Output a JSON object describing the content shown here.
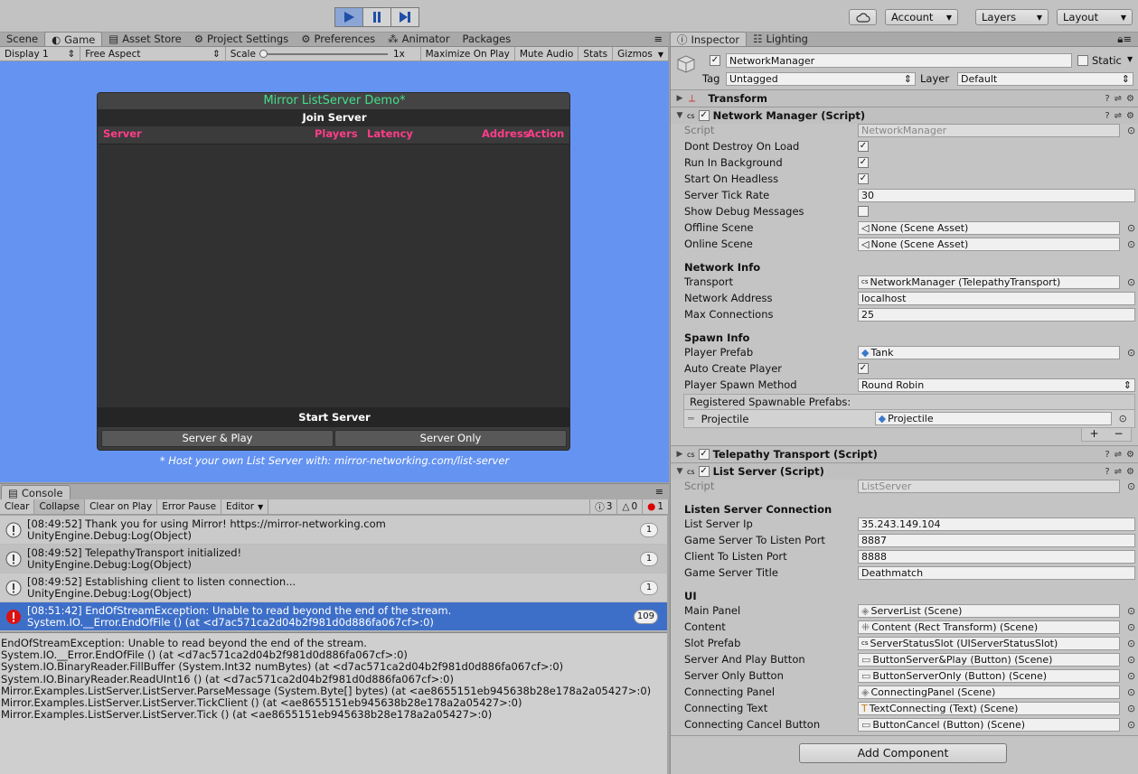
{
  "toolbar": {
    "cloud_icon": "cloud-icon",
    "account": "Account",
    "layers": "Layers",
    "layout": "Layout"
  },
  "left_tabs": [
    "Scene",
    "Game",
    "Asset Store",
    "Project Settings",
    "Preferences",
    "Animator",
    "Packages"
  ],
  "right_tabs": [
    "Inspector",
    "Lighting"
  ],
  "game_toolbar": {
    "display": "Display 1",
    "aspect": "Free Aspect",
    "scale_label": "Scale",
    "scale_value": "1x",
    "maximize": "Maximize On Play",
    "mute": "Mute Audio",
    "stats": "Stats",
    "gizmos": "Gizmos"
  },
  "game_panel": {
    "title": "Mirror ListServer Demo*",
    "join": "Join Server",
    "col_server": "Server",
    "col_players": "Players",
    "col_latency": "Latency",
    "col_address": "Address",
    "col_action": "Action",
    "start": "Start Server",
    "btn_server_play": "Server & Play",
    "btn_server_only": "Server Only",
    "hint": "* Host your own List Server with: mirror-networking.com/list-server"
  },
  "console": {
    "tab": "Console",
    "clear": "Clear",
    "collapse": "Collapse",
    "clear_on_play": "Clear on Play",
    "error_pause": "Error Pause",
    "editor": "Editor",
    "count_info": "3",
    "count_warn": "0",
    "count_error": "1",
    "rows": [
      {
        "line1": "[08:49:52] Thank you for using Mirror! https://mirror-networking.com",
        "line2": "UnityEngine.Debug:Log(Object)",
        "count": "1"
      },
      {
        "line1": "[08:49:52] TelepathyTransport initialized!",
        "line2": "UnityEngine.Debug:Log(Object)",
        "count": "1"
      },
      {
        "line1": "[08:49:52] Establishing client to listen connection...",
        "line2": "UnityEngine.Debug:Log(Object)",
        "count": "1"
      },
      {
        "line1": "[08:51:42] EndOfStreamException: Unable to read beyond the end of the stream.",
        "line2": "System.IO.__Error.EndOfFile () (at <d7ac571ca2d04b2f981d0d886fa067cf>:0)",
        "count": "109"
      }
    ],
    "stack": "EndOfStreamException: Unable to read beyond the end of the stream.\nSystem.IO.__Error.EndOfFile () (at <d7ac571ca2d04b2f981d0d886fa067cf>:0)\nSystem.IO.BinaryReader.FillBuffer (System.Int32 numBytes) (at <d7ac571ca2d04b2f981d0d886fa067cf>:0)\nSystem.IO.BinaryReader.ReadUInt16 () (at <d7ac571ca2d04b2f981d0d886fa067cf>:0)\nMirror.Examples.ListServer.ListServer.ParseMessage (System.Byte[] bytes) (at <ae8655151eb945638b28e178a2a05427>:0)\nMirror.Examples.ListServer.ListServer.TickClient () (at <ae8655151eb945638b28e178a2a05427>:0)\nMirror.Examples.ListServer.ListServer.Tick () (at <ae8655151eb945638b28e178a2a05427>:0)"
  },
  "inspector": {
    "object_name": "NetworkManager",
    "static": "Static",
    "tag_label": "Tag",
    "tag_value": "Untagged",
    "layer_label": "Layer",
    "layer_value": "Default",
    "transform": "Transform",
    "nm_component": "Network Manager (Script)",
    "script_label": "Script",
    "nm_script": "NetworkManager",
    "dont_destroy": "Dont Destroy On Load",
    "run_bg": "Run In Background",
    "start_headless": "Start On Headless",
    "tick_rate_label": "Server Tick Rate",
    "tick_rate": "30",
    "show_debug": "Show Debug Messages",
    "offline_label": "Offline Scene",
    "offline": "None (Scene Asset)",
    "online_label": "Online Scene",
    "online": "None (Scene Asset)",
    "network_info": "Network Info",
    "transport_label": "Transport",
    "transport": "NetworkManager (TelepathyTransport)",
    "address_label": "Network Address",
    "address": "localhost",
    "maxconn_label": "Max Connections",
    "maxconn": "25",
    "spawn_info": "Spawn Info",
    "player_prefab_label": "Player Prefab",
    "player_prefab": "Tank",
    "auto_create": "Auto Create Player",
    "spawn_method_label": "Player Spawn Method",
    "spawn_method": "Round Robin",
    "registered": "Registered Spawnable Prefabs:",
    "proj_label": "Projectile",
    "proj_value": "Projectile",
    "telepathy": "Telepathy Transport (Script)",
    "list_server": "List Server (Script)",
    "ls_script": "ListServer",
    "listen_conn": "Listen Server Connection",
    "ls_ip_label": "List Server Ip",
    "ls_ip": "35.243.149.104",
    "gs_port_label": "Game Server To Listen Port",
    "gs_port": "8887",
    "cl_port_label": "Client To Listen Port",
    "cl_port": "8888",
    "gs_title_label": "Game Server Title",
    "gs_title": "Deathmatch",
    "ui": "UI",
    "ui_rows": [
      {
        "label": "Main Panel",
        "value": "ServerList (Scene)"
      },
      {
        "label": "Content",
        "value": "Content (Rect Transform) (Scene)"
      },
      {
        "label": "Slot Prefab",
        "value": "ServerStatusSlot (UIServerStatusSlot)"
      },
      {
        "label": "Server And Play Button",
        "value": "ButtonServer&Play (Button) (Scene)"
      },
      {
        "label": "Server Only Button",
        "value": "ButtonServerOnly (Button) (Scene)"
      },
      {
        "label": "Connecting Panel",
        "value": "ConnectingPanel (Scene)"
      },
      {
        "label": "Connecting Text",
        "value": "TextConnecting (Text) (Scene)"
      },
      {
        "label": "Connecting Cancel Button",
        "value": "ButtonCancel (Button) (Scene)"
      }
    ],
    "add_component": "Add Component"
  },
  "colors": {
    "game_bg": "#6593f1",
    "panel_title": "#43e08b",
    "header_pink": "#ff3d8a",
    "selected_row": "#3e6fc8"
  }
}
